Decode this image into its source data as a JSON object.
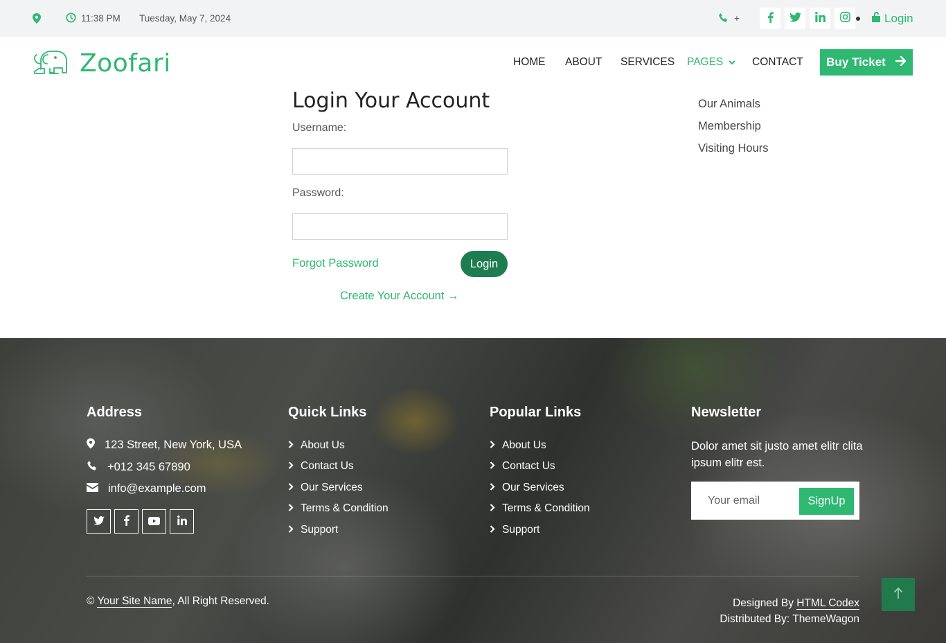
{
  "topbar": {
    "time": "11:38 PM",
    "date": "Tuesday, May 7, 2024",
    "phone_text": "+",
    "login_label": "Login",
    "social": [
      "facebook-icon",
      "twitter-icon",
      "linkedin-icon",
      "instagram-icon"
    ]
  },
  "brand": {
    "name": "Zoofari"
  },
  "nav": {
    "home": "HOME",
    "about": "ABOUT",
    "services": "SERVICES",
    "pages": "PAGES",
    "contact": "CONTACT",
    "buy_ticket": "Buy Ticket"
  },
  "pages_dropdown": [
    "Our Animals",
    "Membership",
    "Visiting Hours"
  ],
  "login": {
    "title": "Login Your Account",
    "username_label": "Username:",
    "password_label": "Password:",
    "username_value": "",
    "password_value": "",
    "forgot": "Forgot Password",
    "submit": "Login",
    "create": "Create Your Account →"
  },
  "footer": {
    "address": {
      "heading": "Address",
      "street": "123 Street, New York, USA",
      "phone": "+012 345 67890",
      "email": "info@example.com",
      "social": [
        "twitter-icon",
        "facebook-icon",
        "youtube-icon",
        "linkedin-icon"
      ]
    },
    "quick_links": {
      "heading": "Quick Links",
      "items": [
        "About Us",
        "Contact Us",
        "Our Services",
        "Terms & Condition",
        "Support"
      ]
    },
    "popular_links": {
      "heading": "Popular Links",
      "items": [
        "About Us",
        "Contact Us",
        "Our Services",
        "Terms & Condition",
        "Support"
      ]
    },
    "newsletter": {
      "heading": "Newsletter",
      "text": "Dolor amet sit justo amet elitr clita ipsum elitr est.",
      "placeholder": "Your email",
      "button": "SignUp"
    },
    "copyright": {
      "symbol": "©",
      "site_name": "Your Site Name",
      "suffix": ", All Right Reserved."
    },
    "credits": {
      "designed_prefix": "Designed By",
      "designed_by": "HTML Codex",
      "distributed": "Distributed By: ThemeWagon"
    }
  },
  "colors": {
    "accent": "#2eb872",
    "login_button": "#1e7d4f",
    "topbar_bg": "#f2f3f4"
  }
}
